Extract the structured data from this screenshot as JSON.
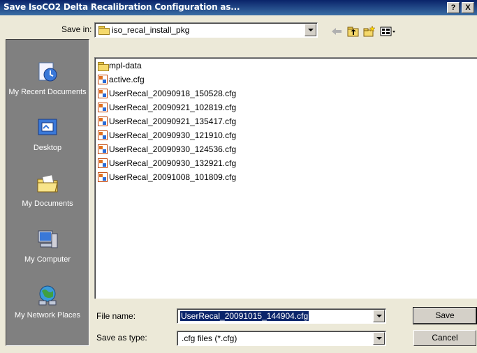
{
  "window": {
    "title": "Save IsoCO2 Delta Recalibration Configuration as...",
    "help_label": "?",
    "close_label": "X"
  },
  "save_in": {
    "label": "Save in:",
    "value": "iso_recal_install_pkg"
  },
  "places": [
    {
      "label": "My Recent Documents",
      "icon": "recent-documents-icon"
    },
    {
      "label": "Desktop",
      "icon": "desktop-icon"
    },
    {
      "label": "My Documents",
      "icon": "my-documents-icon"
    },
    {
      "label": "My Computer",
      "icon": "my-computer-icon"
    },
    {
      "label": "My Network Places",
      "icon": "network-places-icon"
    }
  ],
  "files": [
    {
      "name": "mpl-data",
      "type": "folder"
    },
    {
      "name": "active.cfg",
      "type": "cfg"
    },
    {
      "name": "UserRecal_20090918_150528.cfg",
      "type": "cfg"
    },
    {
      "name": "UserRecal_20090921_102819.cfg",
      "type": "cfg"
    },
    {
      "name": "UserRecal_20090921_135417.cfg",
      "type": "cfg"
    },
    {
      "name": "UserRecal_20090930_121910.cfg",
      "type": "cfg"
    },
    {
      "name": "UserRecal_20090930_124536.cfg",
      "type": "cfg"
    },
    {
      "name": "UserRecal_20090930_132921.cfg",
      "type": "cfg"
    },
    {
      "name": "UserRecal_20091008_101809.cfg",
      "type": "cfg"
    }
  ],
  "file_name": {
    "label": "File name:",
    "value": "UserRecal_20091015_144904.cfg"
  },
  "save_as_type": {
    "label": "Save as type:",
    "value": ".cfg files (*.cfg)"
  },
  "buttons": {
    "save": "Save",
    "cancel": "Cancel"
  },
  "colors": {
    "title_bar": "#0a246a",
    "selection": "#0a246a",
    "dialog_face": "#ece9d8",
    "places_bar": "#808080"
  }
}
